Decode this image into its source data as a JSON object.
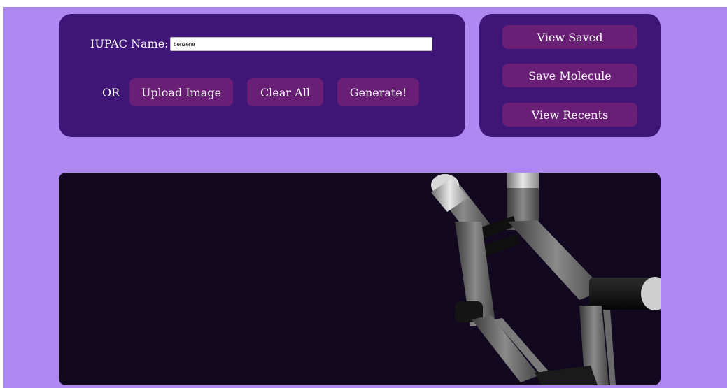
{
  "form": {
    "iupac_label": "IUPAC Name:",
    "iupac_value": "benzene",
    "or_label": "OR",
    "upload_label": "Upload Image",
    "clear_label": "Clear All",
    "generate_label": "Generate!"
  },
  "side_menu": {
    "view_saved_label": "View Saved",
    "save_molecule_label": "Save Molecule",
    "view_recents_label": "View Recents"
  },
  "colors": {
    "page_background": "#ae88f0",
    "panel": "#3f1578",
    "button": "#6a1f77",
    "viewer_background": "#120820"
  }
}
